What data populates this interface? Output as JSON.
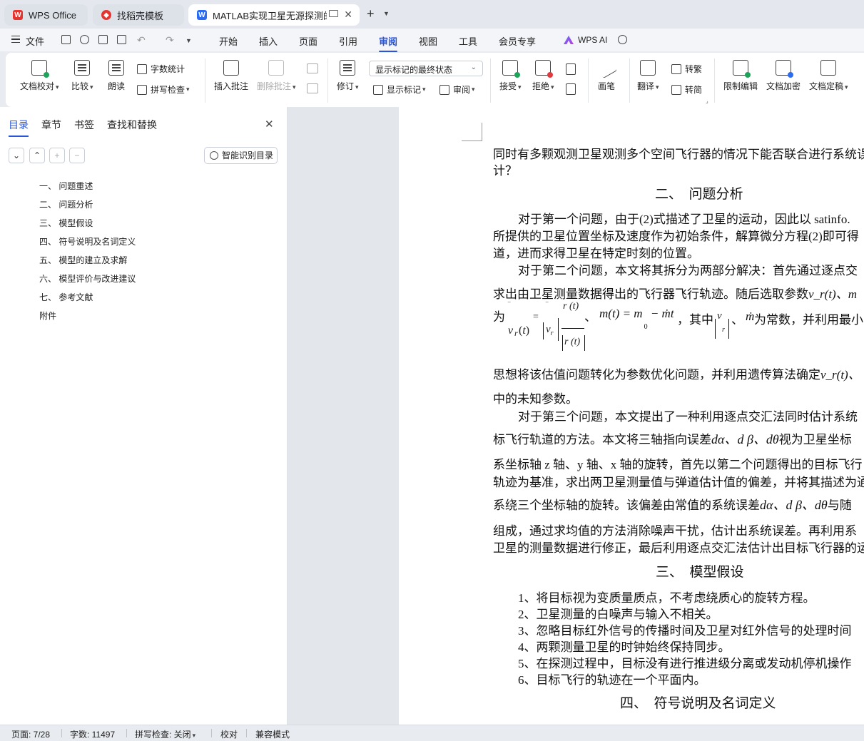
{
  "tabs": [
    {
      "label": "WPS Office"
    },
    {
      "label": "找稻壳模板"
    },
    {
      "label": "MATLAB实现卫星无源探测的"
    }
  ],
  "menu": {
    "file": "文件",
    "items": [
      "开始",
      "插入",
      "页面",
      "引用",
      "审阅",
      "视图",
      "工具",
      "会员专享"
    ],
    "active": "审阅",
    "wps_ai": "WPS AI"
  },
  "ribbon": {
    "doc_proof": "文档校对",
    "compare": "比较",
    "read_aloud": "朗读",
    "word_count": "字数统计",
    "spell_check": "拼写检查",
    "insert_comment": "插入批注",
    "delete_comment": "删除批注",
    "track": "修订",
    "markup_select": "显示标记的最终状态",
    "show_markup": "显示标记",
    "review": "审阅",
    "accept": "接受",
    "reject": "拒绝",
    "pen": "画笔",
    "translate": "翻译",
    "trad_to_simp": "转繁",
    "simp_to_trad": "转简",
    "restrict_edit": "限制编辑",
    "encrypt": "文档加密",
    "finalize": "文档定稿"
  },
  "nav": {
    "tabs": [
      "目录",
      "章节",
      "书签",
      "查找和替换"
    ],
    "smart_toc": "智能识别目录",
    "toc": [
      "一、 问题重述",
      "二、 问题分析",
      "三、 模型假设",
      "四、 符号说明及名词定义",
      "五、 模型的建立及求解",
      "六、 模型评价与改进建议",
      "七、 参考文献",
      "附件"
    ]
  },
  "doc": {
    "lines": [
      "同时有多颗观测卫星观测多个空间飞行器的情况下能否联合进行系统误差估",
      "计？",
      "对于第一个问题，由于(2)式描述了卫星的运动，因此以 satinfo.",
      "所提供的卫星位置坐标及速度作为初始条件，解算微分方程(2)即可得",
      "道，进而求得卫星在特定时刻的位置。",
      "对于第二个问题，本文将其拆分为两部分解决：首先通过逐点交",
      "求出由卫星测量数据得出的飞行器飞行轨迹。随后选取参数",
      "思想将该估值问题转化为参数优化问题，并利用遗传算法确定",
      "中的未知参数。",
      "对于第三个问题，本文提出了一种利用逐点交汇法同时估计系统",
      "标飞行轨道的方法。本文将三轴指向误差",
      "视为卫星坐标",
      "系坐标轴 z 轴、y 轴、x 轴的旋转，首先以第二个问题得出的目标飞行",
      "轨迹为基准，求出两卫星测量值与弹道估计值的偏差，并将其描述为通",
      "系绕三个坐标轴的旋转。该偏差由常值的系统误差",
      "与随",
      "组成，通过求均值的方法消除噪声干扰，估计出系统误差。再利用系",
      "卫星的测量数据进行修正，最后利用逐点交汇法估计出目标飞行器的运"
    ],
    "heading2": "二、　问题分析",
    "heading3": "三、　模型假设",
    "heading4": "四、　符号说明及名词定义",
    "assumptions": [
      "1、将目标视为变质量质点，不考虑绕质心的旋转方程。",
      "2、卫星测量的白噪声与输入不相关。",
      "3、忽略目标红外信号的传播时间及卫星对红外信号的处理时间",
      "4、两颗测量卫星的时钟始终保持同步。",
      "5、在探测过程中，目标没有进行推进级分离或发动机停机操作",
      "6、目标飞行的轨迹在一个平面内。"
    ],
    "formula_prefix": "为",
    "formula_mid": "，其中",
    "formula_tail": "为常数，并利用最小",
    "eq_vr": "v",
    "eq_m": "m(t) = m",
    "eq_m_tail": "− ṁt",
    "eq_mdot": "ṁ",
    "eq_r": "r (t)",
    "params_a": "v_r(t)、m",
    "params_b": "v_r(t)、",
    "angles": "dα、d β、dθ",
    "angles2": "dα、d β、dθ"
  },
  "status": {
    "page": "页面: 7/28",
    "words": "字数: 11497",
    "spell": "拼写检查: 关闭",
    "proof": "校对",
    "compat": "兼容模式"
  }
}
